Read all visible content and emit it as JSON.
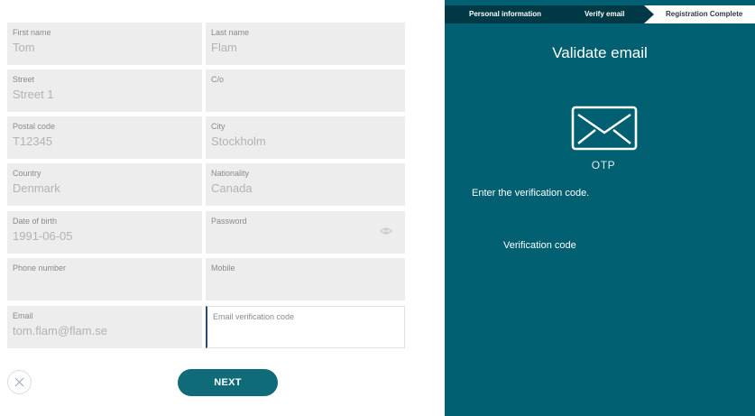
{
  "form": {
    "fields": [
      {
        "id": "first-name",
        "label": "First name",
        "value": "Tom"
      },
      {
        "id": "last-name",
        "label": "Last name",
        "value": "Flam"
      },
      {
        "id": "street",
        "label": "Street",
        "value": "Street 1"
      },
      {
        "id": "co",
        "label": "C/o",
        "value": ""
      },
      {
        "id": "postal-code",
        "label": "Postal code",
        "value": "T12345"
      },
      {
        "id": "city",
        "label": "City",
        "value": "Stockholm"
      },
      {
        "id": "country",
        "label": "Country",
        "value": "Denmark"
      },
      {
        "id": "nationality",
        "label": "Nationality",
        "value": "Canada"
      },
      {
        "id": "date-of-birth",
        "label": "Date of birth",
        "value": "1991-06-05"
      },
      {
        "id": "password",
        "label": "Password",
        "value": ""
      },
      {
        "id": "phone-number",
        "label": "Phone number",
        "value": ""
      },
      {
        "id": "mobile",
        "label": "Mobile",
        "value": ""
      },
      {
        "id": "email",
        "label": "Email",
        "value": "tom.flam@flam.se"
      },
      {
        "id": "email-verification-code",
        "label": "Email verification code",
        "value": ""
      }
    ],
    "next_label": "NEXT",
    "icons": {
      "cancel": "close-icon",
      "password_toggle": "eye-icon"
    },
    "accent_color": "#0f6b78"
  },
  "panel": {
    "steps": [
      {
        "label": "Personal information",
        "state": "done"
      },
      {
        "label": "Verify email",
        "state": "active"
      },
      {
        "label": "Registration Complete",
        "state": "pending"
      }
    ],
    "title": "Validate email",
    "otp_label": "OTP",
    "instruction": "Enter the verification code.",
    "code_label": "Verification code",
    "icon": "envelope-icon",
    "background_color": "#005f70"
  }
}
